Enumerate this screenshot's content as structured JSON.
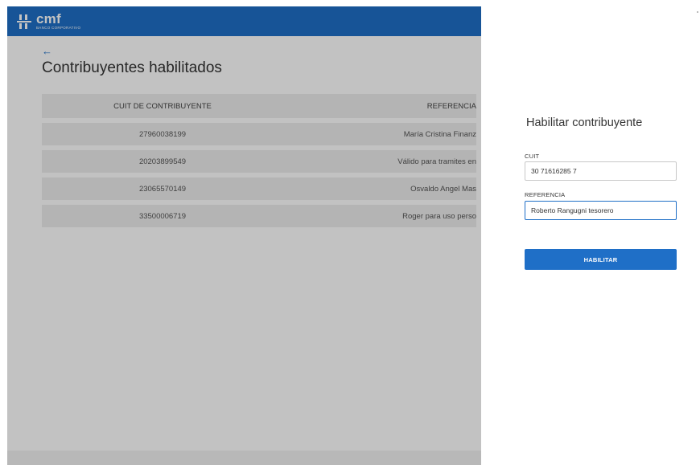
{
  "brand": {
    "name": "cmf",
    "subtitle": "BANCO CORPORATIVO"
  },
  "page": {
    "back_icon": "arrow-left-icon",
    "back_glyph": "←",
    "title": "Contribuyentes habilitados"
  },
  "table": {
    "headers": [
      "CUIT DE CONTRIBUYENTE",
      "REFERENCIA"
    ],
    "rows": [
      {
        "cuit": "27960038199",
        "referencia": "María Cristina Finanz"
      },
      {
        "cuit": "20203899549",
        "referencia": "Válido para tramites en"
      },
      {
        "cuit": "23065570149",
        "referencia": "Osvaldo Angel Mas"
      },
      {
        "cuit": "33500006719",
        "referencia": "Roger para uso perso"
      }
    ]
  },
  "drawer": {
    "title": "Habilitar contribuyente",
    "cuit_label": "CUIT",
    "cuit_value": "30 71616285 7",
    "referencia_label": "REFERENCIA",
    "referencia_value": "Roberto Rangugni tesorero",
    "submit_label": "HABILITAR"
  },
  "colors": {
    "brand_blue": "#1f6fc7",
    "row_bg": "#ededed"
  }
}
